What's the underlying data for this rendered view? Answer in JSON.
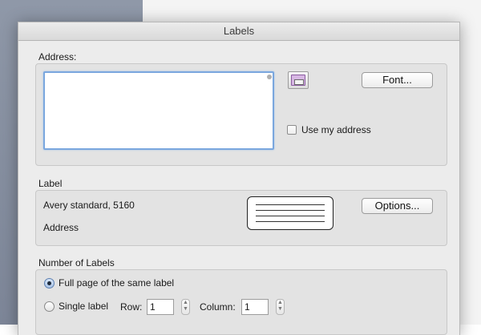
{
  "window": {
    "title": "Labels"
  },
  "address": {
    "section_label": "Address:",
    "text_value": "",
    "font_button": "Font...",
    "use_my_address_label": "Use my address",
    "use_my_address_checked": false
  },
  "label": {
    "section_label": "Label",
    "product": "Avery standard, 5160",
    "type": "Address",
    "options_button": "Options..."
  },
  "number_of_labels": {
    "section_label": "Number of Labels",
    "full_page_label": "Full page of the same label",
    "single_label": "Single label",
    "row_label": "Row:",
    "row_value": "1",
    "column_label": "Column:",
    "column_value": "1",
    "selected": "full_page"
  },
  "colors": {
    "focus_ring": "#7aa7de",
    "dialog_bg": "#ececec"
  },
  "icons": {
    "address_book": "address-book-icon",
    "stepper": "stepper-arrows"
  }
}
